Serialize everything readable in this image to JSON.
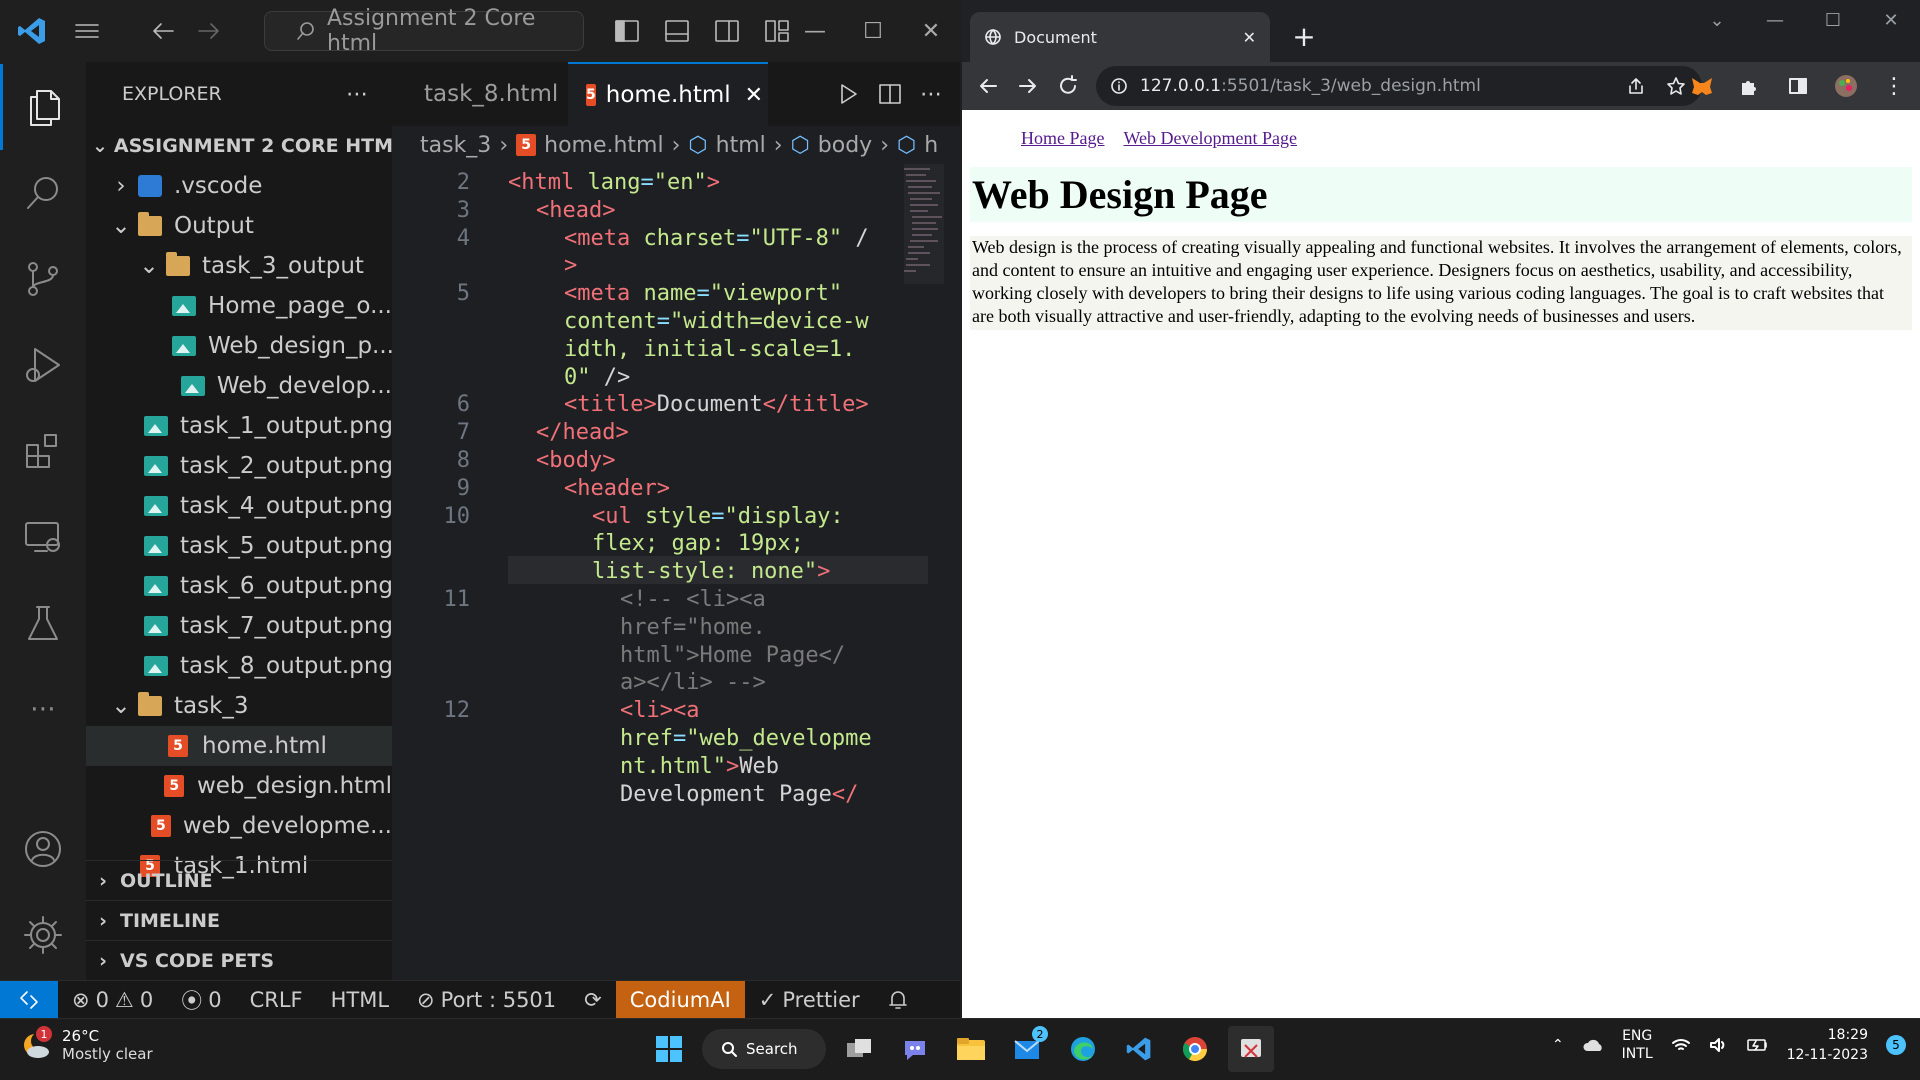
{
  "vscode": {
    "search_text": "Assignment 2 Core html",
    "explorer_title": "EXPLORER",
    "root_label": "ASSIGNMENT 2 CORE HTML",
    "tree": [
      {
        "label": ".vscode",
        "icon": "vscode-folder-icon",
        "depth": 0,
        "chev": "right"
      },
      {
        "label": "Output",
        "icon": "folder-icon",
        "depth": 0,
        "chev": "down"
      },
      {
        "label": "task_3_output",
        "icon": "folder-icon",
        "depth": 1,
        "chev": "down"
      },
      {
        "label": "Home_page_o...",
        "icon": "image-file-icon",
        "depth": 2
      },
      {
        "label": "Web_design_p...",
        "icon": "image-file-icon",
        "depth": 2
      },
      {
        "label": "Web_develop...",
        "icon": "image-file-icon",
        "depth": 2
      },
      {
        "label": "task_1_output.png",
        "icon": "image-file-icon",
        "depth": 1
      },
      {
        "label": "task_2_output.png",
        "icon": "image-file-icon",
        "depth": 1
      },
      {
        "label": "task_4_output.png",
        "icon": "image-file-icon",
        "depth": 1
      },
      {
        "label": "task_5_output.png",
        "icon": "image-file-icon",
        "depth": 1
      },
      {
        "label": "task_6_output.png",
        "icon": "image-file-icon",
        "depth": 1
      },
      {
        "label": "task_7_output.png",
        "icon": "image-file-icon",
        "depth": 1
      },
      {
        "label": "task_8_output.png",
        "icon": "image-file-icon",
        "depth": 1
      },
      {
        "label": "task_3",
        "icon": "folder-icon",
        "depth": 0,
        "chev": "down"
      },
      {
        "label": "home.html",
        "icon": "html5-icon",
        "depth": 1,
        "selected": true
      },
      {
        "label": "web_design.html",
        "icon": "html5-icon",
        "depth": 1
      },
      {
        "label": "web_developme...",
        "icon": "html5-icon",
        "depth": 1
      },
      {
        "label": "task_1.html",
        "icon": "html5-icon",
        "depth": 0
      }
    ],
    "panels": [
      "OUTLINE",
      "TIMELINE",
      "VS CODE PETS"
    ],
    "tabs": [
      {
        "label": "task_8.html",
        "active": false
      },
      {
        "label": "home.html",
        "active": true
      }
    ],
    "breadcrumb": [
      "task_3",
      "home.html",
      "html",
      "body",
      "h"
    ],
    "code_lines": [
      {
        "num": "2",
        "row": 0,
        "indent": 0,
        "parts": [
          [
            "tg",
            "<html "
          ],
          [
            "at",
            "lang"
          ],
          [
            "pn",
            "="
          ],
          [
            "st",
            "\"en\""
          ],
          [
            "tg",
            ">"
          ]
        ]
      },
      {
        "num": "3",
        "row": 1,
        "indent": 1,
        "parts": [
          [
            "tg",
            "<head>"
          ]
        ]
      },
      {
        "num": "4",
        "row": 2,
        "indent": 2,
        "parts": [
          [
            "tg",
            "<meta "
          ],
          [
            "at",
            "charset"
          ],
          [
            "pn",
            "="
          ],
          [
            "st",
            "\"UTF-8\""
          ],
          [
            "tx",
            " /"
          ]
        ]
      },
      {
        "num": "",
        "row": 3,
        "indent": 2,
        "parts": [
          [
            "tg",
            ">"
          ]
        ]
      },
      {
        "num": "5",
        "row": 4,
        "indent": 2,
        "parts": [
          [
            "tg",
            "<meta "
          ],
          [
            "at",
            "name"
          ],
          [
            "pn",
            "="
          ],
          [
            "st",
            "\"viewport\""
          ]
        ]
      },
      {
        "num": "",
        "row": 5,
        "indent": 2,
        "parts": [
          [
            "at",
            "content"
          ],
          [
            "pn",
            "="
          ],
          [
            "st",
            "\"width=device-w"
          ]
        ]
      },
      {
        "num": "",
        "row": 6,
        "indent": 2,
        "parts": [
          [
            "st",
            "idth, initial-scale=1."
          ]
        ]
      },
      {
        "num": "",
        "row": 7,
        "indent": 2,
        "parts": [
          [
            "st",
            "0\""
          ],
          [
            "tx",
            " />"
          ]
        ]
      },
      {
        "num": "6",
        "row": 8,
        "indent": 2,
        "parts": [
          [
            "tg",
            "<title>"
          ],
          [
            "tx",
            "Document"
          ],
          [
            "tg",
            "</title>"
          ]
        ]
      },
      {
        "num": "7",
        "row": 9,
        "indent": 1,
        "parts": [
          [
            "tg",
            "</head>"
          ]
        ]
      },
      {
        "num": "8",
        "row": 10,
        "indent": 1,
        "parts": [
          [
            "tg",
            "<body>"
          ]
        ]
      },
      {
        "num": "9",
        "row": 11,
        "indent": 2,
        "parts": [
          [
            "tg",
            "<header>"
          ]
        ]
      },
      {
        "num": "10",
        "row": 12,
        "indent": 3,
        "parts": [
          [
            "tg",
            "<ul "
          ],
          [
            "at",
            "style"
          ],
          [
            "pn",
            "="
          ],
          [
            "st",
            "\"display:"
          ]
        ]
      },
      {
        "num": "",
        "row": 13,
        "indent": 3,
        "parts": [
          [
            "st",
            "flex; gap: 19px;"
          ]
        ]
      },
      {
        "num": "",
        "row": 14,
        "indent": 3,
        "highlight": true,
        "parts": [
          [
            "st",
            "list-style: none\""
          ],
          [
            "tg",
            ">"
          ]
        ]
      },
      {
        "num": "11",
        "row": 15,
        "indent": 4,
        "parts": [
          [
            "cm",
            "<!-- <li><a"
          ]
        ]
      },
      {
        "num": "",
        "row": 16,
        "indent": 4,
        "parts": [
          [
            "cm",
            "href=\"home."
          ]
        ]
      },
      {
        "num": "",
        "row": 17,
        "indent": 4,
        "parts": [
          [
            "cm",
            "html\">Home Page</"
          ]
        ]
      },
      {
        "num": "",
        "row": 18,
        "indent": 4,
        "parts": [
          [
            "cm",
            "a></li> -->"
          ]
        ]
      },
      {
        "num": "12",
        "row": 19,
        "indent": 4,
        "parts": [
          [
            "tg",
            "<li><a"
          ]
        ]
      },
      {
        "num": "",
        "row": 20,
        "indent": 4,
        "parts": [
          [
            "at",
            "href"
          ],
          [
            "pn",
            "="
          ],
          [
            "st",
            "\"web_developme"
          ]
        ]
      },
      {
        "num": "",
        "row": 21,
        "indent": 4,
        "parts": [
          [
            "st",
            "nt.html\""
          ],
          [
            "tg",
            ">"
          ],
          [
            "tx",
            "Web"
          ]
        ]
      },
      {
        "num": "",
        "row": 22,
        "indent": 4,
        "parts": [
          [
            "tx",
            "Development Page"
          ],
          [
            "tg",
            "</"
          ]
        ]
      }
    ],
    "status": {
      "errors": "0",
      "warnings": "0",
      "ports": "0",
      "eol": "CRLF",
      "language": "HTML",
      "port": "Port : 5501",
      "codium": "CodiumAI",
      "prettier": "Prettier"
    }
  },
  "chrome": {
    "tab_title": "Document",
    "url_host": "127.0.0.1",
    "url_rest": ":5501/task_3/web_design.html"
  },
  "page": {
    "nav": [
      "Home Page",
      "Web Development Page"
    ],
    "heading": "Web Design Page",
    "paragraph": "Web design is the process of creating visually appealing and functional websites. It involves the arrangement of elements, colors, and content to ensure an intuitive and engaging user experience. Designers focus on aesthetics, usability, and accessibility, working closely with developers to bring their designs to life using various coding languages. The goal is to craft websites that are both visually attractive and user-friendly, adapting to the evolving needs of businesses and users."
  },
  "taskbar": {
    "weather_temp": "26°C",
    "weather_desc": "Mostly clear",
    "weather_badge": "1",
    "search_label": "Search",
    "mail_badge": "2",
    "lang_top": "ENG",
    "lang_bottom": "INTL",
    "time": "18:29",
    "date": "12-11-2023",
    "notif_count": "5"
  },
  "colors": {
    "vscode_accent": "#0078d4",
    "codium_bg": "#c46211",
    "html_icon": "#e44d26",
    "link": "#551a8b"
  }
}
